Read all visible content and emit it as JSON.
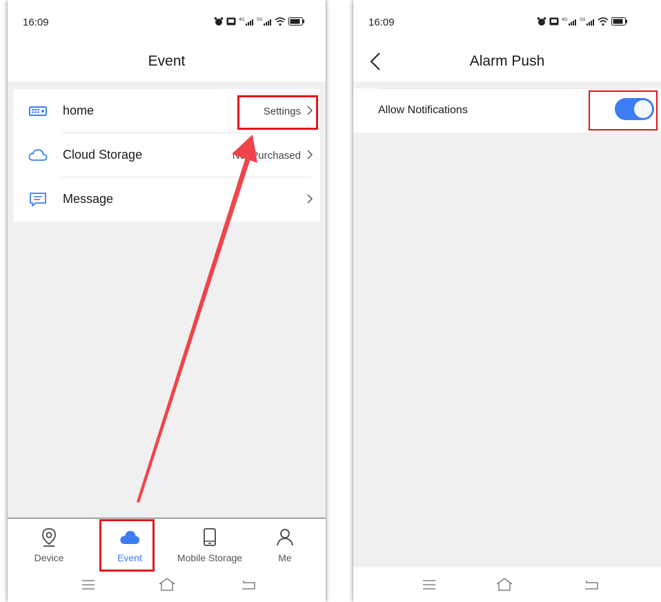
{
  "left_screen": {
    "status_bar": {
      "time": "16:09"
    },
    "header": {
      "title": "Event"
    },
    "list": [
      {
        "label": "home",
        "value": "Settings",
        "icon": "dvr-device-icon"
      },
      {
        "label": "Cloud Storage",
        "value": "Not Purchased",
        "icon": "cloud-outline-icon"
      },
      {
        "label": "Message",
        "value": "",
        "icon": "message-icon"
      }
    ],
    "tabs": [
      {
        "label": "Device",
        "icon": "location-pin-icon",
        "active": false
      },
      {
        "label": "Event",
        "icon": "cloud-filled-icon",
        "active": true
      },
      {
        "label": "Mobile Storage",
        "icon": "phone-icon",
        "active": false
      },
      {
        "label": "Me",
        "icon": "person-icon",
        "active": false
      }
    ]
  },
  "right_screen": {
    "status_bar": {
      "time": "16:09"
    },
    "header": {
      "title": "Alarm Push"
    },
    "settings": [
      {
        "label": "Allow Notifications",
        "enabled": true
      }
    ]
  },
  "colors": {
    "accent": "#3d7df3",
    "highlight": "#e3141c",
    "arrow": "#f0444a",
    "background": "#f0f0f0"
  }
}
